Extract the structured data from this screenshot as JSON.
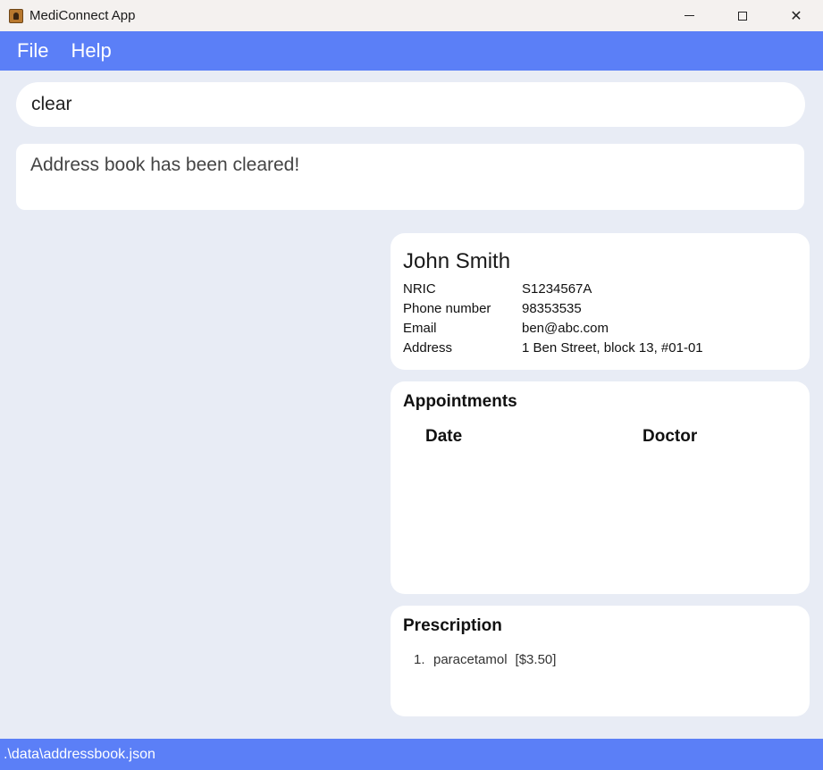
{
  "window": {
    "title": "MediConnect App",
    "icon": "contact-book-icon",
    "controls": [
      "minimize-icon",
      "maximize-icon",
      "close-icon"
    ],
    "close_glyph": "✕"
  },
  "menu": {
    "items": [
      {
        "label": "File"
      },
      {
        "label": "Help"
      }
    ]
  },
  "command": {
    "value": "clear"
  },
  "result": {
    "message": "Address book has been cleared!"
  },
  "person": {
    "name": "John Smith",
    "fields": [
      {
        "label": "NRIC",
        "value": "S1234567A"
      },
      {
        "label": "Phone number",
        "value": "98353535"
      },
      {
        "label": "Email",
        "value": "ben@abc.com"
      },
      {
        "label": "Address",
        "value": "1 Ben Street, block 13, #01-01"
      }
    ]
  },
  "appointments": {
    "heading": "Appointments",
    "columns": [
      "Date",
      "Doctor"
    ],
    "rows": []
  },
  "prescription": {
    "heading": "Prescription",
    "items": [
      {
        "number": "1.",
        "name": "paracetamol",
        "price": "[$3.50]"
      }
    ]
  },
  "status": {
    "path": ".\\data\\addressbook.json"
  },
  "colors": {
    "accent": "#5b7ff7",
    "background": "#e8ecf5",
    "card": "#ffffff"
  }
}
